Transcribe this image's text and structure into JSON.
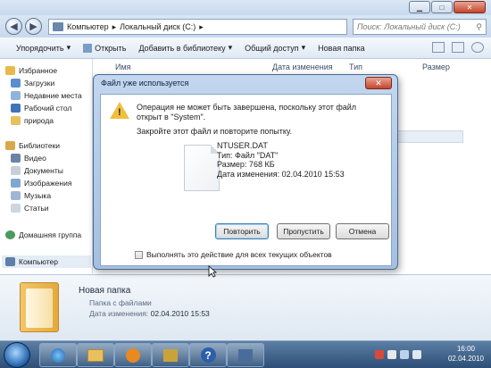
{
  "explorer": {
    "breadcrumb": [
      "Компьютер",
      "Локальный диск (C:)"
    ],
    "search_placeholder": "Поиск: Локальный диск (C:)",
    "toolbar": {
      "organize": "Упорядочить",
      "open": "Открыть",
      "add_to_library": "Добавить в библиотеку",
      "share": "Общий доступ",
      "new_folder": "Новая папка"
    },
    "columns": {
      "name": "Имя",
      "date": "Дата изменения",
      "type": "Тип",
      "size": "Размер"
    },
    "sidebar": {
      "favorites": "Избранное",
      "downloads": "Загрузки",
      "recent": "Недавние места",
      "desktop": "Рабочий стол",
      "priroda": "природа",
      "libraries": "Библиотеки",
      "video": "Видео",
      "documents": "Документы",
      "pictures": "Изображения",
      "music": "Музыка",
      "articles": "Статьи",
      "homegroup": "Домашняя группа",
      "computer": "Компьютер"
    },
    "details": {
      "name": "Новая папка",
      "type": "Папка с файлами",
      "modified_label": "Дата изменения:",
      "modified_value": "02.04.2010 15:53"
    }
  },
  "dialog": {
    "title": "Файл уже используется",
    "message": "Операция не может быть завершена, поскольку этот файл открыт в \"System\".",
    "instruction": "Закройте этот файл и повторите попытку.",
    "file": {
      "name": "NTUSER.DAT",
      "type": "Тип: Файл \"DAT\"",
      "size": "Размер: 768 КБ",
      "modified": "Дата изменения: 02.04.2010 15:53"
    },
    "buttons": {
      "retry": "Повторить",
      "skip": "Пропустить",
      "cancel": "Отмена"
    },
    "checkbox_label": "Выполнять это действие для всех текущих объектов"
  },
  "taskbar": {
    "time": "16:00",
    "date": "02.04.2010"
  },
  "icons": {
    "warning": "warning-icon",
    "file": "file-icon",
    "folder": "folder-icon",
    "start": "start-orb-icon"
  },
  "colors": {
    "accent": "#3c7fb1",
    "warning": "#f0c03c"
  }
}
